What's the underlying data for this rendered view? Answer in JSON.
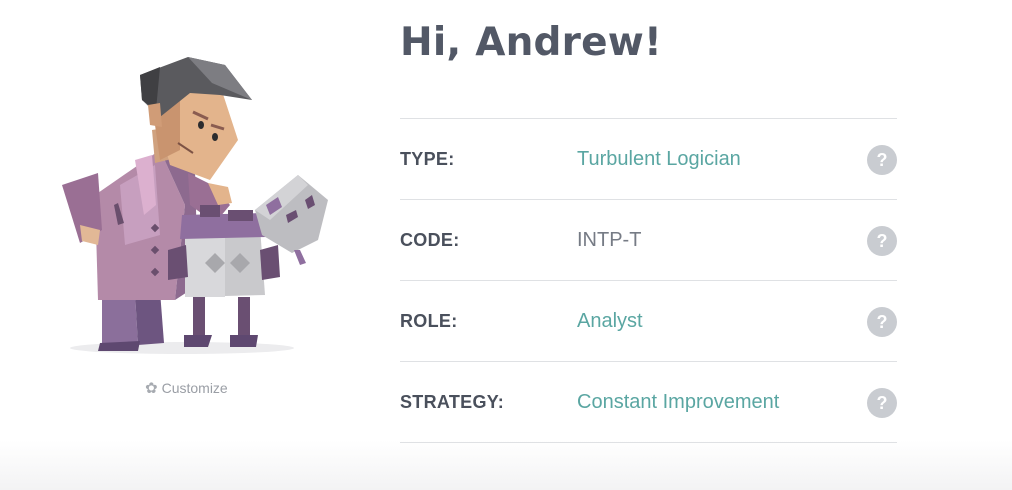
{
  "greeting": "Hi, Andrew!",
  "customize": {
    "icon": "star-icon",
    "label": "Customize"
  },
  "profile": [
    {
      "label": "TYPE:",
      "value": "Turbulent Logician",
      "value_style": "accent",
      "help": "?"
    },
    {
      "label": "CODE:",
      "value": "INTP-T",
      "value_style": "plain",
      "help": "?"
    },
    {
      "label": "ROLE:",
      "value": "Analyst",
      "value_style": "accent",
      "help": "?"
    },
    {
      "label": "STRATEGY:",
      "value": "Constant Improvement",
      "value_style": "accent",
      "help": "?"
    }
  ],
  "colors": {
    "accent": "#5aa6a2",
    "heading": "#525866",
    "help_bg": "#c9ccd1",
    "divider": "#dfe1e4"
  }
}
